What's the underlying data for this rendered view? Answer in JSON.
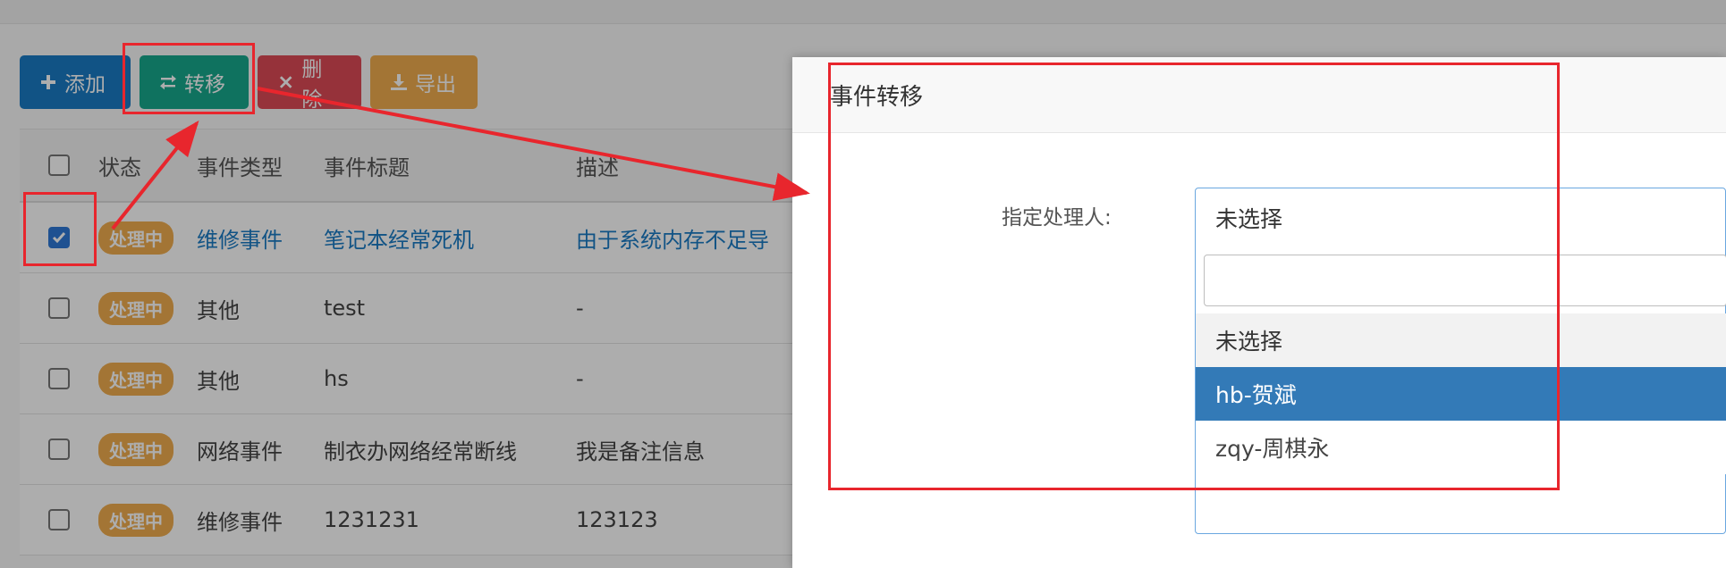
{
  "toolbar": {
    "add_label": "添加",
    "transfer_label": "转移",
    "delete_label": "删除",
    "export_label": "导出"
  },
  "table": {
    "headers": [
      "状态",
      "事件类型",
      "事件标题",
      "描述"
    ],
    "rows": [
      {
        "checked": true,
        "status": "处理中",
        "type": "维修事件",
        "title": "笔记本经常死机",
        "desc": "由于系统内存不足导"
      },
      {
        "checked": false,
        "status": "处理中",
        "type": "其他",
        "title": "test",
        "desc": "-"
      },
      {
        "checked": false,
        "status": "处理中",
        "type": "其他",
        "title": "hs",
        "desc": "-"
      },
      {
        "checked": false,
        "status": "处理中",
        "type": "网络事件",
        "title": "制衣办网络经常断线",
        "desc": "我是备注信息"
      },
      {
        "checked": false,
        "status": "处理中",
        "type": "维修事件",
        "title": "1231231",
        "desc": "123123"
      }
    ]
  },
  "modal": {
    "title": "事件转移",
    "field_label": "指定处理人:",
    "select_current": "未选择",
    "search_value": "",
    "options": [
      "未选择",
      "hb-贺斌",
      "zqy-周棋永"
    ],
    "highlighted_option": "hb-贺斌"
  },
  "colors": {
    "primary": "#1a7bc4",
    "success": "#17a88c",
    "danger": "#dd4b56",
    "warning": "#f0ad4e",
    "annotation": "#e8262d"
  }
}
